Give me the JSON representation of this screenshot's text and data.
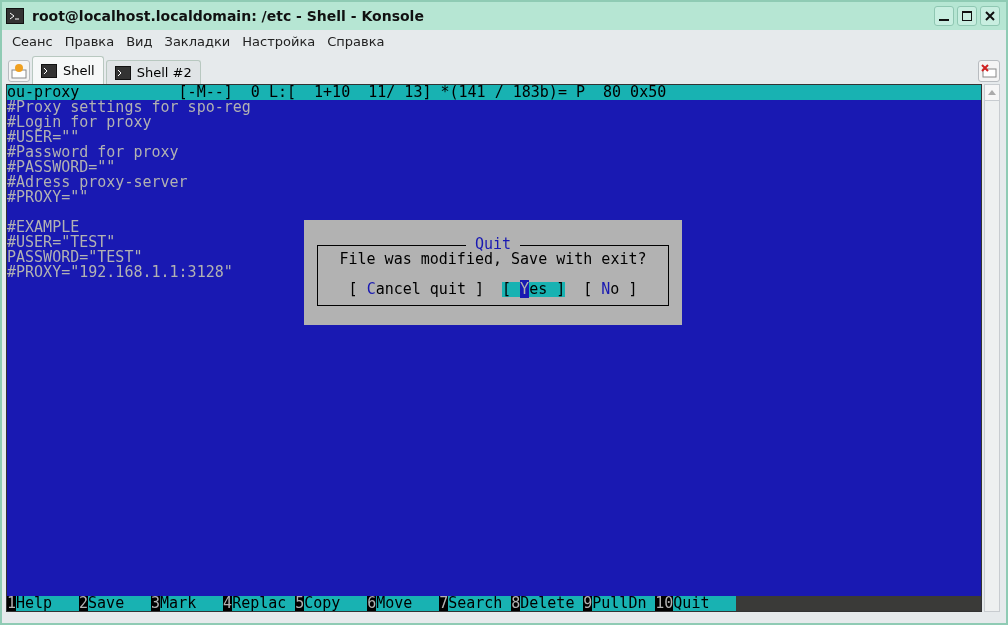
{
  "window": {
    "title": "root@localhost.localdomain: /etc - Shell - Konsole"
  },
  "menu": [
    "Сеанс",
    "Правка",
    "Вид",
    "Закладки",
    "Настройка",
    "Справка"
  ],
  "tabs": [
    {
      "label": "Shell",
      "selected": true
    },
    {
      "label": "Shell #2",
      "selected": false
    }
  ],
  "editor": {
    "status_line": "ou-proxy           [-M--]  0 L:[  1+10  11/ 13] *(141 / 183b)= P  80 0x50",
    "blocks": [
      [
        "#Proxy settings for spo-reg",
        "#Login for proxy",
        "#USER=\"\"",
        "#Password for proxy",
        "#PASSWORD=\"\"",
        "#Adress proxy-server",
        "#PROXY=\"\""
      ],
      [
        "#EXAMPLE",
        "#USER=\"TEST\"",
        "PASSWORD=\"TEST\"",
        "#PROXY=\"192.168.1.1:3128\""
      ]
    ]
  },
  "dialog": {
    "title": "Quit",
    "message": "File was modified, Save with exit?",
    "buttons": [
      {
        "open": "[",
        "hotkey": "C",
        "rest": "ancel quit",
        "close": "]",
        "selected": false
      },
      {
        "open": "[",
        "hotkey": "Y",
        "rest": "es",
        "close": "]",
        "selected": true
      },
      {
        "open": "[",
        "hotkey": "N",
        "rest": "o",
        "close": "]",
        "selected": false
      }
    ]
  },
  "function_keys": [
    {
      "key": "1",
      "label": "Help"
    },
    {
      "key": "2",
      "label": "Save"
    },
    {
      "key": "3",
      "label": "Mark"
    },
    {
      "key": "4",
      "label": "Replac"
    },
    {
      "key": "5",
      "label": "Copy"
    },
    {
      "key": "6",
      "label": "Move"
    },
    {
      "key": "7",
      "label": "Search"
    },
    {
      "key": "8",
      "label": "Delete"
    },
    {
      "key": "9",
      "label": "PullDn"
    },
    {
      "key": "10",
      "label": "Quit"
    }
  ]
}
